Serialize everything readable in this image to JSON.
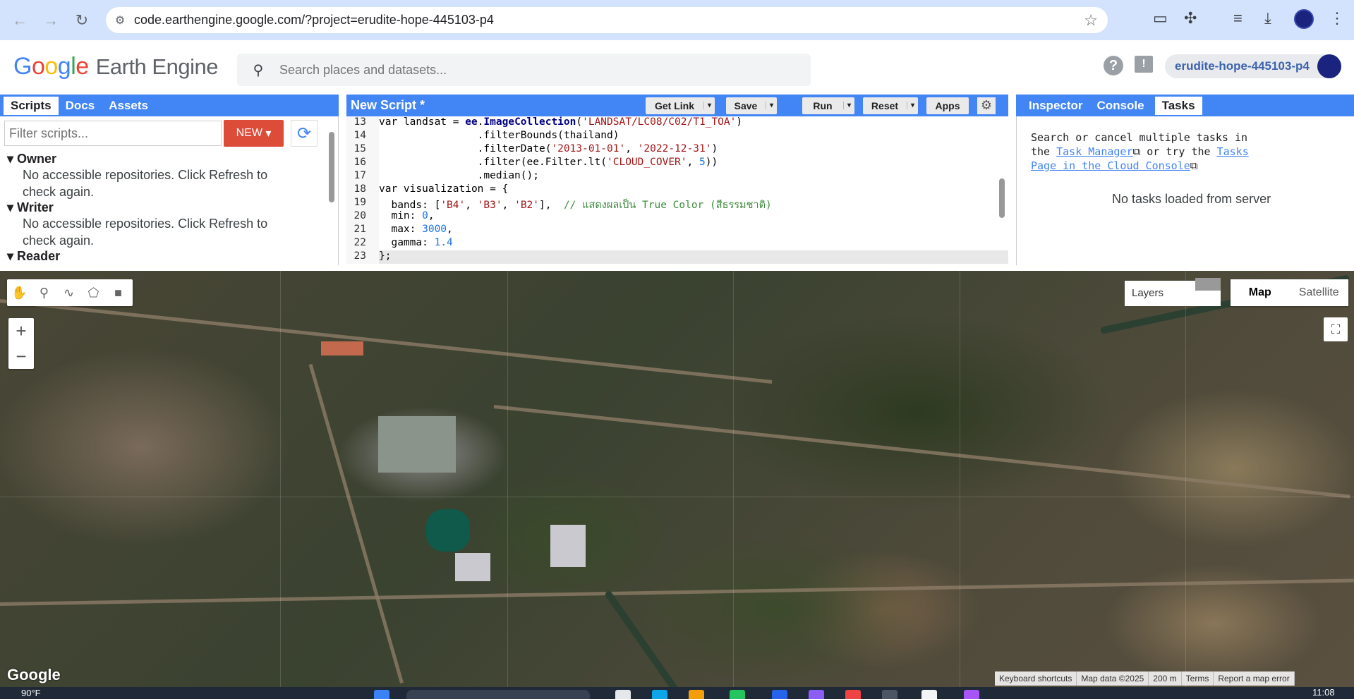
{
  "browser": {
    "url": "code.earthengine.google.com/?project=erudite-hope-445103-p4"
  },
  "header": {
    "logo_google": "Google",
    "logo_product": "Earth Engine",
    "search_placeholder": "Search places and datasets...",
    "project": "erudite-hope-445103-p4"
  },
  "left_panel": {
    "tabs": [
      "Scripts",
      "Docs",
      "Assets"
    ],
    "filter_placeholder": "Filter scripts...",
    "new_label": "NEW",
    "groups": [
      {
        "name": "Owner",
        "message": "No accessible repositories. Click Refresh to check again."
      },
      {
        "name": "Writer",
        "message": "No accessible repositories. Click Refresh to check again."
      },
      {
        "name": "Reader",
        "message": ""
      }
    ]
  },
  "editor": {
    "title": "New Script *",
    "buttons": {
      "get_link": "Get Link",
      "save": "Save",
      "run": "Run",
      "reset": "Reset",
      "apps": "Apps"
    },
    "lines": [
      {
        "n": "13",
        "html": "var landsat = <span class=\"fn\">ee</span>.<span class=\"fn\">ImageCollection</span>(<span class=\"str\">'LANDSAT/LC08/C02/T1_TOA'</span>)"
      },
      {
        "n": "14",
        "html": "                .filterBounds(thailand)"
      },
      {
        "n": "15",
        "html": "                .filterDate(<span class=\"str\">'2013-01-01'</span>, <span class=\"str\">'2022-12-31'</span>)"
      },
      {
        "n": "16",
        "html": "                .filter(ee.Filter.lt(<span class=\"str\">'CLOUD_COVER'</span>, <span class=\"num\">5</span>))"
      },
      {
        "n": "17",
        "html": "                .median();"
      },
      {
        "n": "18",
        "html": "var visualization = {"
      },
      {
        "n": "19",
        "html": "  bands: [<span class=\"str\">'B4'</span>, <span class=\"str\">'B3'</span>, <span class=\"str\">'B2'</span>],  <span class=\"cmt\">// แสดงผลเป็น True Color (สีธรรมชาติ)</span>"
      },
      {
        "n": "20",
        "html": "  min: <span class=\"num\">0</span>,"
      },
      {
        "n": "21",
        "html": "  max: <span class=\"num\">3000</span>,"
      },
      {
        "n": "22",
        "html": "  gamma: <span class=\"num\">1.4</span>"
      },
      {
        "n": "23",
        "html": "};"
      }
    ]
  },
  "right_panel": {
    "tabs": [
      "Inspector",
      "Console",
      "Tasks"
    ],
    "tasks_pre": "Search or cancel multiple tasks in the ",
    "task_manager_link": "Task Manager",
    "tasks_mid": " or try the ",
    "tasks_page_link": "Tasks Page in the Cloud Console",
    "no_tasks": "No tasks loaded from server"
  },
  "map": {
    "layers_label": "Layers",
    "map_type": [
      "Map",
      "Satellite"
    ],
    "selected_map_type": "Map",
    "watermark": "Google",
    "attribution": [
      "Keyboard shortcuts",
      "Map data ©2025",
      "200 m",
      "Terms",
      "Report a map error"
    ]
  },
  "taskbar": {
    "weather": "90°F",
    "time": "11:08"
  }
}
